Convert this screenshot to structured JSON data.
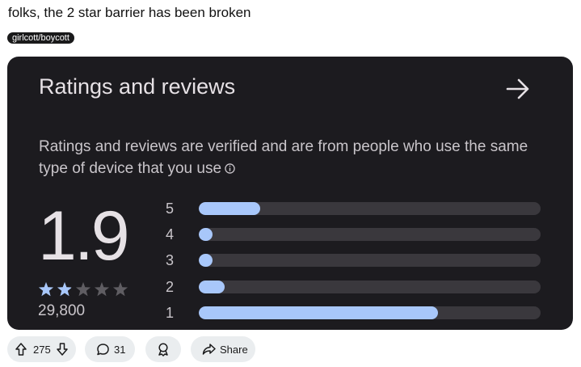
{
  "post": {
    "title": "folks, the 2 star barrier has been broken",
    "flair": "girlcott/boycott"
  },
  "card": {
    "title": "Ratings and reviews",
    "arrow_icon": "arrow-right-icon",
    "description": "Ratings and reviews are verified and are from people who use the same type of device that you use",
    "info_icon": "info-icon",
    "rating": "1.9",
    "rating_value": 1.9,
    "star_count": 5,
    "review_count": "29,800",
    "bars": [
      {
        "label": "5",
        "fraction": 0.18
      },
      {
        "label": "4",
        "fraction": 0.04
      },
      {
        "label": "3",
        "fraction": 0.04
      },
      {
        "label": "2",
        "fraction": 0.075
      },
      {
        "label": "1",
        "fraction": 0.7
      }
    ],
    "colors": {
      "background": "#1c1b1f",
      "bar_fill": "#a8c7fa",
      "bar_track": "#3a383d",
      "star_filled": "#a8c7fa",
      "star_empty": "#5f5d62"
    }
  },
  "actions": {
    "upvote_count": "275",
    "comment_count": "31",
    "share_label": "Share",
    "icons": [
      "upvote-icon",
      "downvote-icon",
      "comment-icon",
      "award-icon",
      "share-icon"
    ]
  }
}
